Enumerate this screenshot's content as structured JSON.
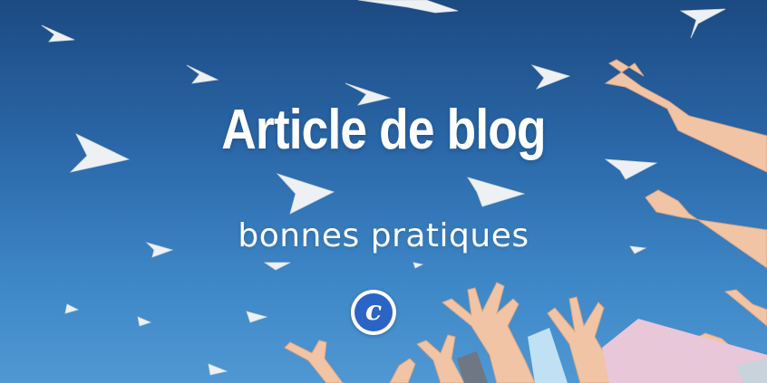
{
  "banner": {
    "title": "Article de blog",
    "subtitle": "bonnes pratiques",
    "logo_letter": "c"
  },
  "colors": {
    "sky_top": "#1c4a82",
    "sky_bottom": "#4f98d3",
    "text": "#ffffff",
    "logo_blue": "#2a64c4",
    "paper_plane": "#eef1f4",
    "skin": "#f2c4a6"
  },
  "scene": {
    "description_icons": [
      "paper-plane-icon",
      "raised-hand"
    ]
  }
}
